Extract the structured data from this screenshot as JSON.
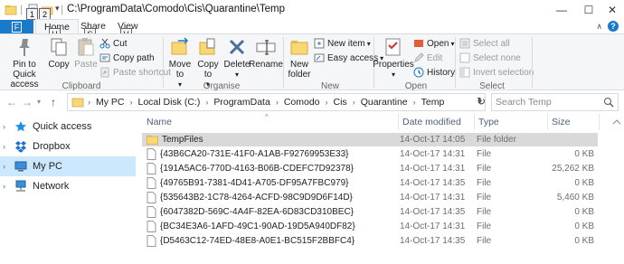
{
  "window": {
    "title": "C:\\ProgramData\\Comodo\\Cis\\Quarantine\\Temp",
    "keytips": [
      "1",
      "2",
      "F",
      "H",
      "S",
      "V"
    ]
  },
  "ribbon": {
    "tabs": {
      "file": "File",
      "home": "Home",
      "share": "Share",
      "view": "View"
    },
    "clipboard": {
      "pin": "Pin to Quick access",
      "copy": "Copy",
      "paste": "Paste",
      "cut": "Cut",
      "copy_path": "Copy path",
      "paste_shortcut": "Paste shortcut",
      "label": "Clipboard"
    },
    "organise": {
      "move_to": "Move to",
      "copy_to": "Copy to",
      "delete": "Delete",
      "rename": "Rename",
      "label": "Organise"
    },
    "new": {
      "new_folder": "New folder",
      "new_item": "New item",
      "easy_access": "Easy access",
      "label": "New"
    },
    "open": {
      "properties": "Properties",
      "open": "Open",
      "edit": "Edit",
      "history": "History",
      "label": "Open"
    },
    "select": {
      "select_all": "Select all",
      "select_none": "Select none",
      "invert": "Invert selection",
      "label": "Select"
    }
  },
  "address": {
    "crumbs": [
      "My PC",
      "Local Disk (C:)",
      "ProgramData",
      "Comodo",
      "Cis",
      "Quarantine",
      "Temp"
    ],
    "search_placeholder": "Search Temp"
  },
  "nav": {
    "items": [
      {
        "label": "Quick access",
        "icon": "star-icon"
      },
      {
        "label": "Dropbox",
        "icon": "dropbox-icon"
      },
      {
        "label": "My PC",
        "icon": "computer-icon"
      },
      {
        "label": "Network",
        "icon": "network-icon"
      }
    ]
  },
  "columns": {
    "name": "Name",
    "date": "Date modified",
    "type": "Type",
    "size": "Size"
  },
  "files": [
    {
      "name": "TempFiles",
      "date": "14-Oct-17 14:05",
      "type": "File folder",
      "size": ""
    },
    {
      "name": "{43B6CA20-731E-41F0-A1AB-F92769953E33}",
      "date": "14-Oct-17 14:31",
      "type": "File",
      "size": "0 KB"
    },
    {
      "name": "{191A5AC6-770D-4163-B06B-CDEFC7D92378}",
      "date": "14-Oct-17 14:31",
      "type": "File",
      "size": "25,262 KB"
    },
    {
      "name": "{49765B91-7381-4D41-A705-DF95A7FBC979}",
      "date": "14-Oct-17 14:35",
      "type": "File",
      "size": "0 KB"
    },
    {
      "name": "{535643B2-1C78-4264-ACFD-98C9D9D6F14D}",
      "date": "14-Oct-17 14:31",
      "type": "File",
      "size": "5,460 KB"
    },
    {
      "name": "{6047382D-569C-4A4F-82EA-6D83CD310BEC}",
      "date": "14-Oct-17 14:35",
      "type": "File",
      "size": "0 KB"
    },
    {
      "name": "{BC34E3A6-1AFD-49C1-90AD-19D5A940DF82}",
      "date": "14-Oct-17 14:31",
      "type": "File",
      "size": "0 KB"
    },
    {
      "name": "{D5463C12-74ED-48E8-A0E1-BC515F2BBFC4}",
      "date": "14-Oct-17 14:35",
      "type": "File",
      "size": "0 KB"
    }
  ],
  "colors": {
    "accent": "#1979ca",
    "selected_nav": "#cce8ff",
    "selected_row": "#d9d9d9",
    "folder": "#f8d775"
  }
}
